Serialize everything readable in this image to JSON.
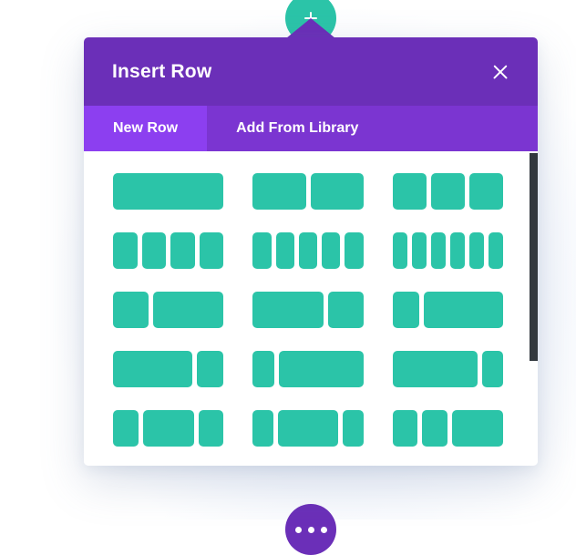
{
  "add_row_button": {
    "icon": "plus-icon",
    "label": ""
  },
  "more_options_button": {
    "icon": "ellipsis-icon",
    "label": ""
  },
  "modal": {
    "title": "Insert Row",
    "close_icon": "close-icon",
    "colors": {
      "header_purple": "#6B2FB8",
      "tab_bar_purple": "#7B35D1",
      "active_tab_purple": "#8C3FF0",
      "column_teal": "#2BC4A8",
      "scrollbar_dark": "#32383E",
      "modal_background": "#ffffff"
    },
    "tabs": [
      {
        "label": "New Row",
        "active": true
      },
      {
        "label": "Add From Library",
        "active": false
      }
    ],
    "layouts": [
      {
        "name": "1 column",
        "fractions": [
          1
        ]
      },
      {
        "name": "2 columns",
        "fractions": [
          1,
          1
        ]
      },
      {
        "name": "3 columns",
        "fractions": [
          1,
          1,
          1
        ]
      },
      {
        "name": "4 columns",
        "fractions": [
          1,
          1,
          1,
          1
        ]
      },
      {
        "name": "5 columns",
        "fractions": [
          1,
          1,
          1,
          1,
          1
        ]
      },
      {
        "name": "6 columns",
        "fractions": [
          1,
          1,
          1,
          1,
          1,
          1
        ]
      },
      {
        "name": "1/3 + 2/3",
        "fractions": [
          1,
          2
        ]
      },
      {
        "name": "2/3 + 1/3",
        "fractions": [
          2,
          1
        ]
      },
      {
        "name": "1/4 + 3/4",
        "fractions": [
          1,
          3
        ]
      },
      {
        "name": "3/4 + 1/4",
        "fractions": [
          3,
          1
        ]
      },
      {
        "name": "1/5 + 4/5",
        "fractions": [
          1,
          4
        ]
      },
      {
        "name": "4/5 + 1/5",
        "fractions": [
          4,
          1
        ]
      },
      {
        "name": "1/4 + 1/2 + 1/4",
        "fractions": [
          1,
          2,
          1
        ]
      },
      {
        "name": "1/5 + 3/5 + 1/5",
        "fractions": [
          1,
          3,
          1
        ]
      },
      {
        "name": "1/4 + 1/4 + 1/2",
        "fractions": [
          1,
          1,
          2
        ]
      }
    ],
    "scrollbar": {
      "visible": true
    }
  }
}
